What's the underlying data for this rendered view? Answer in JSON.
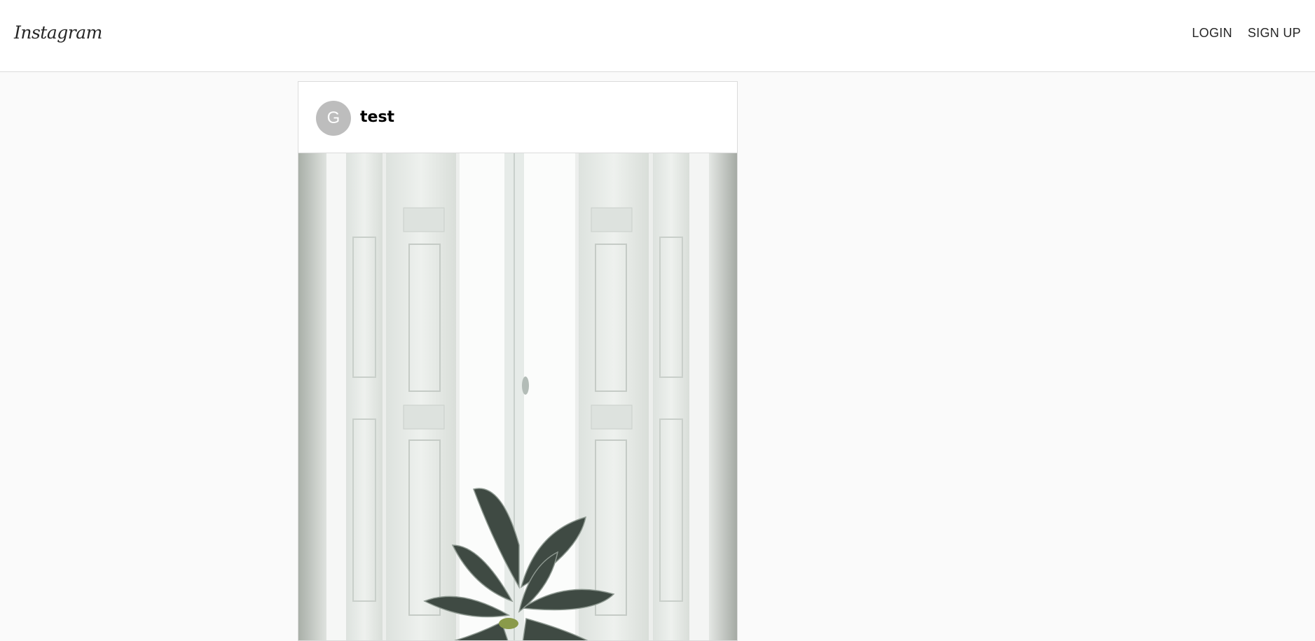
{
  "header": {
    "logo_text": "Instagram",
    "nav": {
      "login_label": "LOGIN",
      "signup_label": "SIGN UP"
    }
  },
  "post": {
    "avatar_initial": "G",
    "username": "test",
    "image_alt": "white window shutters with a potted plant"
  },
  "colors": {
    "background": "#fafafa",
    "border": "#dbdbdb",
    "avatar": "#bdbdbd"
  }
}
